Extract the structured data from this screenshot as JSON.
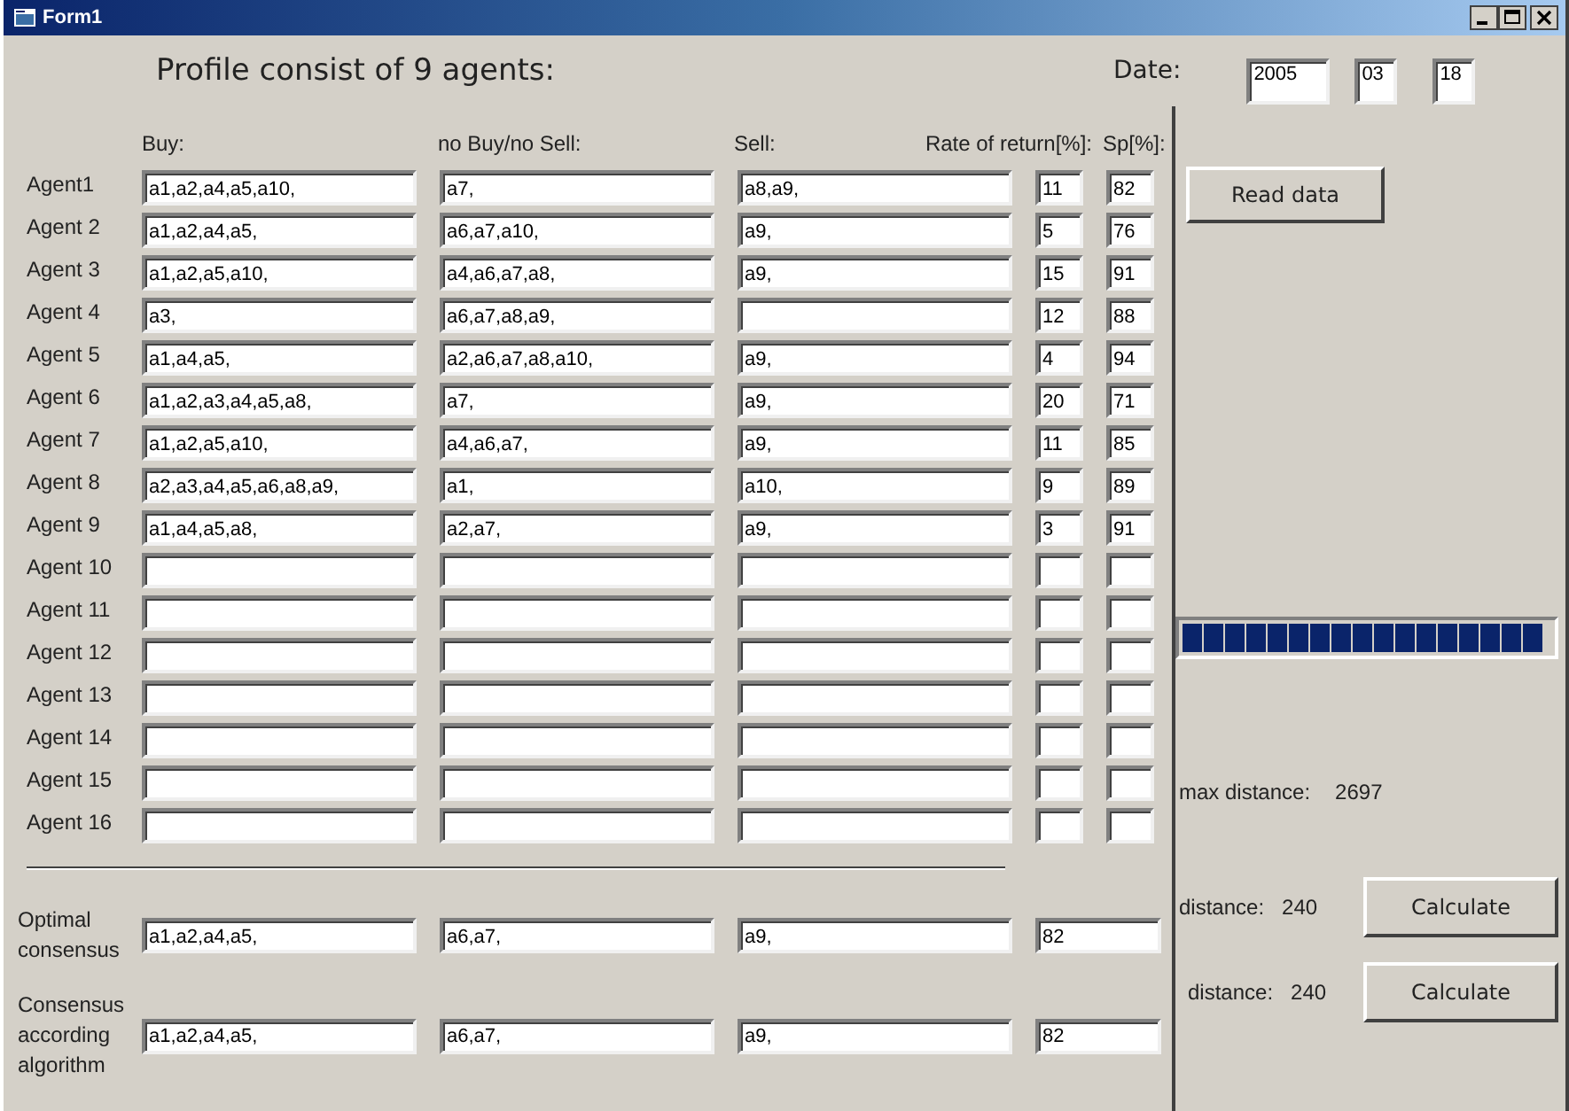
{
  "window": {
    "title": "Form1"
  },
  "heading": "Profile consist of 9 agents:",
  "date": {
    "label": "Date:",
    "year": "2005",
    "month": "03",
    "day": "18"
  },
  "columns": [
    "Buy:",
    "no Buy/no Sell:",
    "Sell:",
    "Rate of return[%]:",
    "Sp[%]:"
  ],
  "agents": [
    {
      "label": "Agent1",
      "buy": "a1,a2,a4,a5,a10,",
      "neutral": "a7,",
      "sell": "a8,a9,",
      "rate": "11",
      "sp": "82"
    },
    {
      "label": "Agent 2",
      "buy": "a1,a2,a4,a5,",
      "neutral": "a6,a7,a10,",
      "sell": "a9,",
      "rate": "5",
      "sp": "76"
    },
    {
      "label": "Agent 3",
      "buy": "a1,a2,a5,a10,",
      "neutral": "a4,a6,a7,a8,",
      "sell": "a9,",
      "rate": "15",
      "sp": "91"
    },
    {
      "label": "Agent 4",
      "buy": "a3,",
      "neutral": "a6,a7,a8,a9,",
      "rate": "12",
      "sp": "88"
    },
    {
      "label": "Agent 5",
      "buy": "a1,a4,a5,",
      "neutral": "a2,a6,a7,a8,a10,",
      "sell": "a9,",
      "rate": "4",
      "sp": "94"
    },
    {
      "label": "Agent 6",
      "buy": "a1,a2,a3,a4,a5,a8,",
      "neutral": "a7,",
      "sell": "a9,",
      "rate": "20",
      "sp": "71"
    },
    {
      "label": "Agent 7",
      "buy": "a1,a2,a5,a10,",
      "neutral": "a4,a6,a7,",
      "sell": "a9,",
      "rate": "11",
      "sp": "85"
    },
    {
      "label": "Agent 8",
      "buy": "a2,a3,a4,a5,a6,a8,a9,",
      "neutral": "a1,",
      "sell": "a10,",
      "rate": "9",
      "sp": "89"
    },
    {
      "label": "Agent 9",
      "buy": "a1,a4,a5,a8,",
      "neutral": "a2,a7,",
      "sell": "a9,",
      "rate": "3",
      "sp": "91"
    },
    {
      "label": "Agent 10"
    },
    {
      "label": "Agent 11"
    },
    {
      "label": "Agent 12"
    },
    {
      "label": "Agent 13"
    },
    {
      "label": "Agent 14"
    },
    {
      "label": "Agent 15"
    },
    {
      "label": "Agent 16"
    }
  ],
  "consensus": [
    {
      "label": "Optimal consensus",
      "buy": "a1,a2,a4,a5,",
      "neutral": "a6,a7,",
      "sell": "a9,",
      "sp": "82"
    },
    {
      "label": "Consensus according algorithm",
      "buy": "a1,a2,a4,a5,",
      "neutral": "a6,a7,",
      "sell": "a9,",
      "sp": "82"
    }
  ],
  "side": {
    "read_button": "Read data",
    "progress": {
      "level": 1
    },
    "max_distance": {
      "label": "max distance:",
      "value": "2697"
    },
    "results": [
      {
        "label": "distance:",
        "value": "240",
        "button": "Calculate"
      },
      {
        "label": "distance:",
        "value": "240",
        "button": "Calculate"
      }
    ]
  }
}
